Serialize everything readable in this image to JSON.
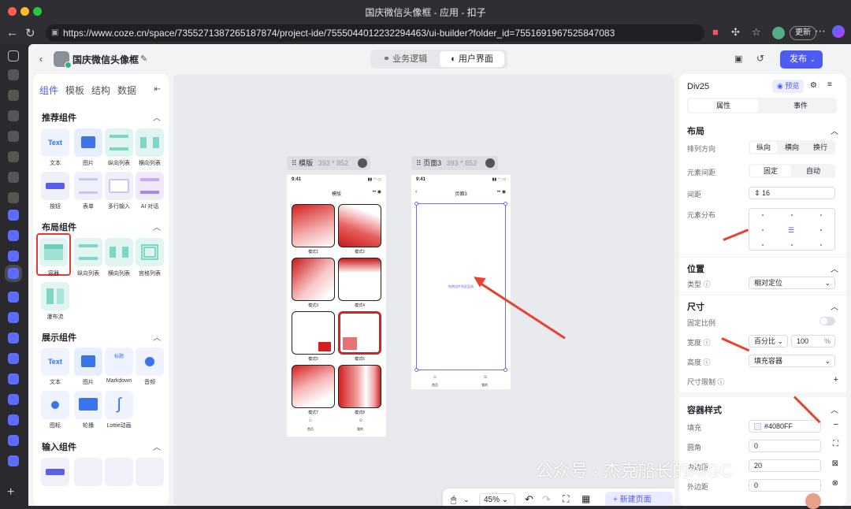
{
  "window": {
    "title": "国庆微信头像框 - 应用 - 扣子"
  },
  "browser": {
    "url": "https://www.coze.cn/space/7355271387265187874/project-ide/7555044012232294463/ui-builder?folder_id=7551691967525847083",
    "update_label": "更新"
  },
  "header": {
    "project_name": "国庆微信头像框",
    "tab_logic": "业务逻辑",
    "tab_ui": "用户界面",
    "publish_label": "发布"
  },
  "left": {
    "tabs": [
      "组件",
      "模板",
      "结构",
      "数据"
    ],
    "sections": {
      "recommended": "推荐组件",
      "layout": "布局组件",
      "display": "展示组件",
      "input": "输入组件"
    },
    "recommended": [
      "文本",
      "图片",
      "纵向列表",
      "横向列表",
      "按钮",
      "表单",
      "多行输入",
      "AI 对话"
    ],
    "layout": [
      "容器",
      "纵向列表",
      "横向列表",
      "宫格列表",
      "瀑布流"
    ],
    "display": [
      "文本",
      "图片",
      "Markdown",
      "音频",
      "图标",
      "轮播",
      "Lottie动画"
    ],
    "icon_text": "Text",
    "icon_md": "标题"
  },
  "canvas": {
    "frame1": {
      "name": "模版",
      "size": "393 * 852",
      "time": "9:41",
      "title": "模版",
      "tiles": [
        "模式1",
        "模式2",
        "模式3",
        "模式4",
        "模式5",
        "模式6",
        "模式7",
        "模式8"
      ],
      "tab1": "首页",
      "tab2": "我的"
    },
    "frame2": {
      "name": "页面3",
      "size": "393 * 852",
      "time": "9:41",
      "title": "页面3",
      "placeholder": "拖拽组件到此容器",
      "tab1": "首页",
      "tab2": "我的"
    },
    "zoom": "45%",
    "new_page": "新建页面"
  },
  "right": {
    "element": "Div25",
    "preview": "预览",
    "tab_props": "属性",
    "tab_events": "事件",
    "layout": {
      "title": "布局",
      "direction_label": "排列方向",
      "dir_opts": [
        "纵向",
        "横向",
        "换行"
      ],
      "spacing_label": "元素间距",
      "spacing_opts": [
        "固定",
        "自动"
      ],
      "gap_label": "间距",
      "gap_value": "16",
      "dist_label": "元素分布"
    },
    "position": {
      "title": "位置",
      "type_label": "类型",
      "type_value": "相对定位"
    },
    "size": {
      "title": "尺寸",
      "ratio_label": "固定比例",
      "width_label": "宽度",
      "width_unit": "百分比",
      "width_value": "100",
      "width_suffix": "%",
      "height_label": "高度",
      "height_value": "填充容器",
      "limit_label": "尺寸限制"
    },
    "style": {
      "title": "容器样式",
      "fill_label": "填充",
      "fill_value": "#4080FF",
      "radius_label": "圆角",
      "radius_value": "0",
      "padding_label": "内边距",
      "padding_value": "20",
      "margin_label": "外边距",
      "margin_value": "0"
    }
  },
  "watermark": "公众号 · 杰克船长的AIGC",
  "colors": {
    "accent": "#4e5bf2",
    "arrow": "#e8412f",
    "select": "#e53935",
    "fill": "#4080FF"
  }
}
